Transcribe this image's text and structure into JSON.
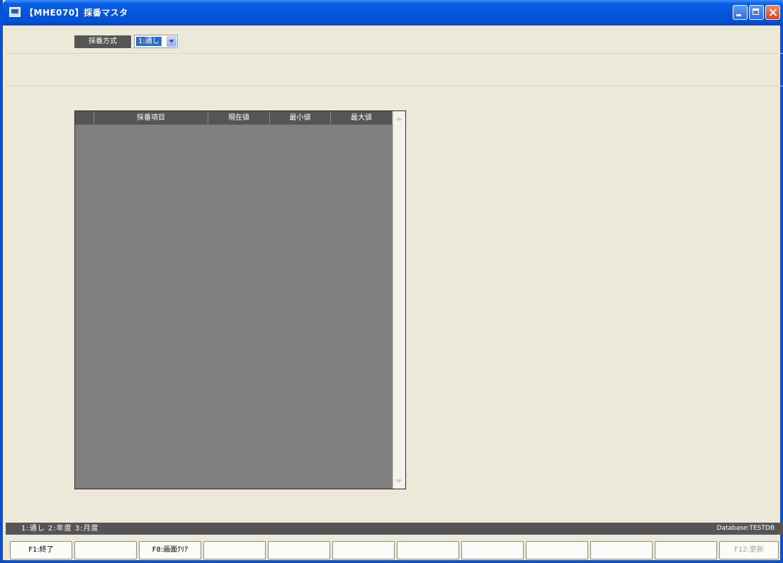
{
  "window": {
    "title": "【MHE070】採番マスタ",
    "colors": {
      "titlebar": "#0355dc",
      "panel": "#ece9d8",
      "grid": "#808080",
      "header": "#555555"
    }
  },
  "method": {
    "label": "採番方式",
    "selected": "1:通し"
  },
  "grid": {
    "columns": [
      "",
      "採番項目",
      "現在値",
      "最小値",
      "最大値"
    ],
    "rows": []
  },
  "status": {
    "hint": "1:通し 2:年度 3:月度",
    "database": "Database:TESTDB"
  },
  "function_keys": [
    "F1:終了",
    "",
    "F8:画面ｸﾘｱ",
    "",
    "",
    "",
    "",
    "",
    "",
    "",
    "",
    "F12:更新"
  ]
}
